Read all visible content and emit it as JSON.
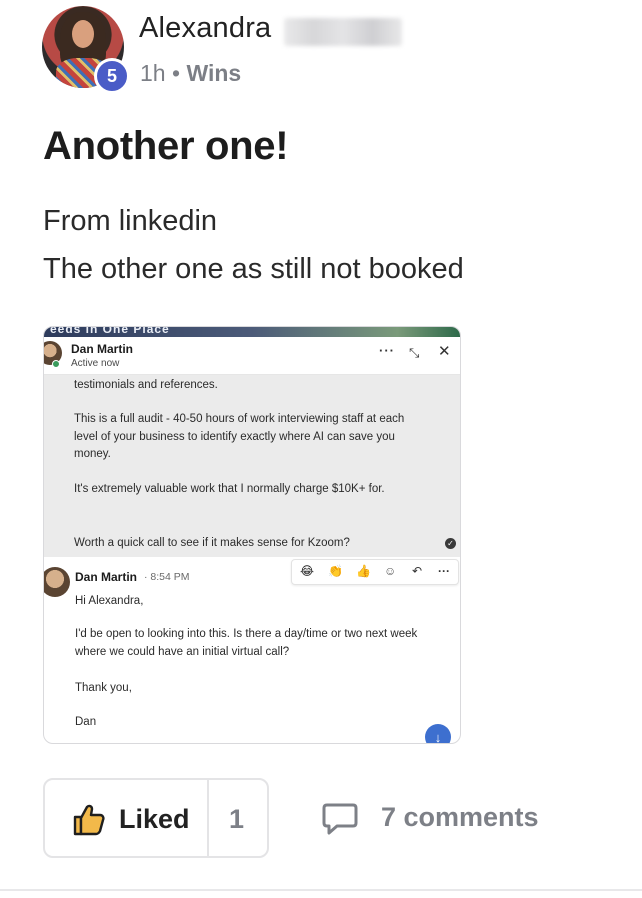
{
  "post": {
    "author": "Alexandra",
    "level": "5",
    "time": "1h",
    "separator": "•",
    "category": "Wins",
    "title": "Another one!",
    "body_lines": [
      "From linkedin",
      "The other one as still not booked"
    ]
  },
  "screenshot": {
    "banner_text": "eeds in One Place",
    "contact_name": "Dan Martin",
    "contact_status": "Active now",
    "controls": {
      "more": "···",
      "minimize": "⤡",
      "close": "✕"
    },
    "sent_messages": [
      "testimonials and references.",
      "This is a full audit - 40-50 hours of work interviewing staff at each level of your business to identify exactly where AI can save you money.",
      "It's extremely valuable work that I normally charge $10K+ for.",
      "Worth a quick call to see if it makes sense for Kzoom?"
    ],
    "reply": {
      "name": "Dan Martin",
      "time": "· 8:54 PM",
      "lines": [
        "Hi Alexandra,",
        "I'd be open to looking into this.  Is there a day/time or two next week where we could have an initial virtual call?",
        "Thank you,",
        "Dan"
      ]
    },
    "reactions": [
      "😂",
      "👏",
      "👍",
      "☺",
      "↶",
      "···"
    ]
  },
  "actions": {
    "like_label": "Liked",
    "like_count": "1",
    "comments_label": "7 comments"
  },
  "colors": {
    "badge": "#4a5cc7",
    "muted_text": "#7c7f86",
    "like_icon_fill": "#f2b94a",
    "scroll_button": "#3d6fcf"
  },
  "icons": {
    "like": "thumbs-up-icon",
    "comment": "speech-bubble-icon"
  }
}
